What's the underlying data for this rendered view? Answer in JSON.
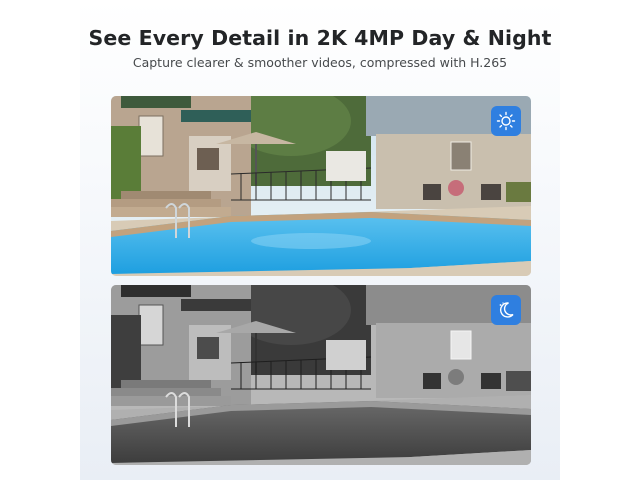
{
  "header": {
    "title": "See Every Detail in 2K 4MP Day & Night",
    "subtitle": "Capture clearer & smoother videos, compressed with H.265"
  },
  "images": [
    {
      "mode": "day",
      "icon": "sun-icon",
      "badge_color": "#2f7fe0"
    },
    {
      "mode": "night",
      "icon": "moon-icon",
      "badge_color": "#2f7fe0"
    }
  ]
}
